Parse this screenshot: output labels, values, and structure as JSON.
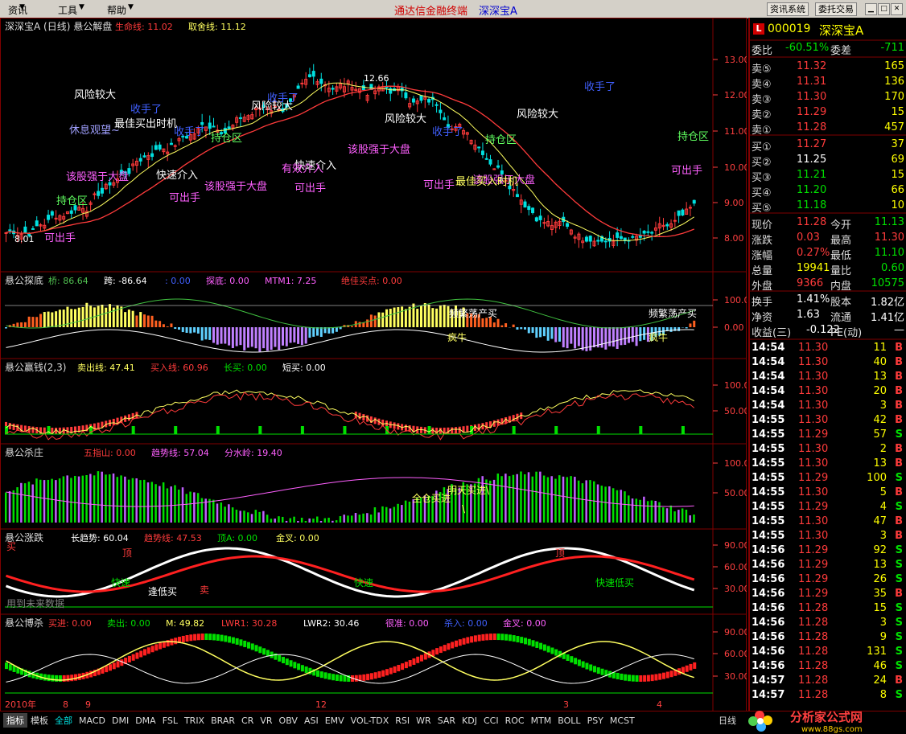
{
  "menubar": {
    "items": [
      "资讯",
      "工具",
      "帮助"
    ],
    "app_title": "通达信金融终端",
    "stock_title": "深深宝A",
    "buttons": [
      "资讯系统",
      "委托交易"
    ]
  },
  "main_chart": {
    "header": "深深宝A (日线) 悬公解盘",
    "lines": [
      {
        "label": "生命线:",
        "value": "11.02",
        "color": "#ff3b3b"
      },
      {
        "label": "取舍线:",
        "value": "11.12",
        "color": "#ffff60"
      }
    ],
    "y_ticks": [
      "13.00",
      "12.00",
      "11.00",
      "10.00",
      "9.00",
      "8.00"
    ],
    "high_label": "12.66",
    "low_label": "8.01",
    "annotations": [
      "风险较大",
      "风险较大",
      "风险较大",
      "风险较大",
      "收手了",
      "收手了",
      "收手了",
      "收手了",
      "收手了",
      "可出手",
      "可出手",
      "可出手",
      "可出手",
      "可出手",
      "持仓区",
      "持仓区",
      "持仓区",
      "持仓区",
      "该股强于大盘",
      "该股强于大盘",
      "该股强于大盘",
      "该股强于大盘",
      "快速介入",
      "快速介入",
      "有效介入",
      "休息观望~",
      "最佳买入时机",
      "最佳买出时机"
    ]
  },
  "panel2": {
    "header": "悬公探底",
    "fields": [
      {
        "label": "桥:",
        "value": "86.64",
        "color": "#50c050"
      },
      {
        "label": "跨:",
        "value": "-86.64",
        "color": "#ffffff"
      },
      {
        "label": ":",
        "value": "0.00",
        "color": "#4060ff"
      },
      {
        "label": "探底:",
        "value": "0.00",
        "color": "#ff60ff"
      },
      {
        "label": "MTM1:",
        "value": "7.25",
        "color": "#ff60ff"
      },
      {
        "label": "绝佳买点:",
        "value": "0.00",
        "color": "#ff3b3b"
      }
    ],
    "y_ticks": [
      "100.0",
      "0.00"
    ],
    "annotations": [
      "疯牛",
      "疯牛",
      "频繁荡产买",
      "频繁荡产买"
    ]
  },
  "panel3": {
    "header": "悬公赢钱(2,3)",
    "fields": [
      {
        "label": "卖出线:",
        "value": "47.41",
        "color": "#ffff60"
      },
      {
        "label": "买入线:",
        "value": "60.96",
        "color": "#ff3b3b"
      },
      {
        "label": "长买:",
        "value": "0.00",
        "color": "#00e000"
      },
      {
        "label": "短买:",
        "value": "0.00",
        "color": "#ffffff"
      }
    ],
    "y_ticks": [
      "100.0",
      "50.00"
    ]
  },
  "panel4": {
    "header": "悬公杀庄",
    "fields": [
      {
        "label": "五指山:",
        "value": "0.00",
        "color": "#ff3b3b"
      },
      {
        "label": "趋势线:",
        "value": "57.04",
        "color": "#ff60ff"
      },
      {
        "label": "分水岭:",
        "value": "19.40",
        "color": "#ff60ff"
      }
    ],
    "y_ticks": [
      "100.0",
      "50.00"
    ],
    "annotations": [
      "全仓买进",
      "明天买进\\",
      "\\"
    ]
  },
  "panel5": {
    "header": "悬公涨跌",
    "fields": [
      {
        "label": "长趋势:",
        "value": "60.04",
        "color": "#ffffff"
      },
      {
        "label": "趋势线:",
        "value": "47.53",
        "color": "#ff3b3b"
      },
      {
        "label": "顶A:",
        "value": "0.00",
        "color": "#00e000"
      },
      {
        "label": "金叉:",
        "value": "0.00",
        "color": "#ffff60"
      }
    ],
    "y_ticks": [
      "90.00",
      "60.00",
      "30.00"
    ],
    "annotations": [
      "快速",
      "快速",
      "快速低买",
      "逢低买",
      "买",
      "卖",
      "顶",
      "顶",
      "用到未来数据"
    ]
  },
  "panel6": {
    "header": "悬公博杀",
    "fields": [
      {
        "label": "买进:",
        "value": "0.00",
        "color": "#ff3b3b"
      },
      {
        "label": "卖出:",
        "value": "0.00",
        "color": "#00e000"
      },
      {
        "label": "M:",
        "value": "49.82",
        "color": "#ffff60"
      },
      {
        "label": "LWR1:",
        "value": "30.28",
        "color": "#ff3b3b"
      },
      {
        "label": "LWR2:",
        "value": "30.46",
        "color": "#ffffff"
      },
      {
        "label": "很准:",
        "value": "0.00",
        "color": "#ff60ff"
      },
      {
        "label": "杀入:",
        "value": "0.00",
        "color": "#4060ff"
      },
      {
        "label": "金叉:",
        "value": "0.00",
        "color": "#ff60ff"
      }
    ],
    "y_ticks": [
      "90.00",
      "60.00",
      "30.00"
    ]
  },
  "date_axis": [
    "2010年",
    "8",
    "9",
    "12",
    "3",
    "4"
  ],
  "bottom": {
    "tabs": [
      "指标",
      "模板",
      "全部",
      "MACD",
      "DMI",
      "DMA",
      "FSL",
      "TRIX",
      "BRAR",
      "CR",
      "VR",
      "OBV",
      "ASI",
      "EMV",
      "VOL-TDX",
      "RSI",
      "WR",
      "SAR",
      "KDJ",
      "CCI",
      "ROC",
      "MTM",
      "BOLL",
      "PSY",
      "MCST"
    ],
    "period": "日线",
    "logo_text": "分析家公式网",
    "logo_url": "www.88gs.com"
  },
  "quote": {
    "code": "000019",
    "name": "深深宝A",
    "wei_bi_label": "委比",
    "wei_bi": "-60.51%",
    "wei_cha_label": "委差",
    "wei_cha": "-711",
    "sells": [
      {
        "label": "卖⑤",
        "price": "11.32",
        "vol": "165"
      },
      {
        "label": "卖④",
        "price": "11.31",
        "vol": "136"
      },
      {
        "label": "卖③",
        "price": "11.30",
        "vol": "170"
      },
      {
        "label": "卖②",
        "price": "11.29",
        "vol": "15"
      },
      {
        "label": "卖①",
        "price": "11.28",
        "vol": "457"
      }
    ],
    "buys": [
      {
        "label": "买①",
        "price": "11.27",
        "vol": "37"
      },
      {
        "label": "买②",
        "price": "11.25",
        "vol": "69"
      },
      {
        "label": "买③",
        "price": "11.21",
        "vol": "15"
      },
      {
        "label": "买④",
        "price": "11.20",
        "vol": "66"
      },
      {
        "label": "买⑤",
        "price": "11.18",
        "vol": "10"
      }
    ],
    "stats": [
      {
        "l1": "现价",
        "v1": "11.28",
        "c1": "#ff3b3b",
        "l2": "今开",
        "v2": "11.13",
        "c2": "#00e000"
      },
      {
        "l1": "涨跌",
        "v1": "0.03",
        "c1": "#ff3b3b",
        "l2": "最高",
        "v2": "11.30",
        "c2": "#ff3b3b"
      },
      {
        "l1": "涨幅",
        "v1": "0.27%",
        "c1": "#ff3b3b",
        "l2": "最低",
        "v2": "11.10",
        "c2": "#00e000"
      },
      {
        "l1": "总量",
        "v1": "19941",
        "c1": "#ffff00",
        "l2": "量比",
        "v2": "0.60",
        "c2": "#00e000"
      },
      {
        "l1": "外盘",
        "v1": "9366",
        "c1": "#ff3b3b",
        "l2": "内盘",
        "v2": "10575",
        "c2": "#00e000"
      },
      {
        "l1": "换手",
        "v1": "1.41%",
        "c1": "#ffffff",
        "l2": "股本",
        "v2": "1.82亿",
        "c2": "#ffffff"
      },
      {
        "l1": "净资",
        "v1": "1.63",
        "c1": "#ffffff",
        "l2": "流通",
        "v2": "1.41亿",
        "c2": "#ffffff"
      },
      {
        "l1": "收益(三)",
        "v1": "-0.122",
        "c1": "#ffffff",
        "l2": "PE(动)",
        "v2": "—",
        "c2": "#ffffff"
      }
    ],
    "ticks": [
      {
        "time": "14:54",
        "price": "11.30",
        "vol": "11",
        "side": "B"
      },
      {
        "time": "14:54",
        "price": "11.30",
        "vol": "40",
        "side": "B"
      },
      {
        "time": "14:54",
        "price": "11.30",
        "vol": "13",
        "side": "B"
      },
      {
        "time": "14:54",
        "price": "11.30",
        "vol": "20",
        "side": "B"
      },
      {
        "time": "14:54",
        "price": "11.30",
        "vol": "3",
        "side": "B"
      },
      {
        "time": "14:55",
        "price": "11.30",
        "vol": "42",
        "side": "B"
      },
      {
        "time": "14:55",
        "price": "11.29",
        "vol": "57",
        "side": "S"
      },
      {
        "time": "14:55",
        "price": "11.30",
        "vol": "2",
        "side": "B"
      },
      {
        "time": "14:55",
        "price": "11.30",
        "vol": "13",
        "side": "B"
      },
      {
        "time": "14:55",
        "price": "11.29",
        "vol": "100",
        "side": "S"
      },
      {
        "time": "14:55",
        "price": "11.30",
        "vol": "5",
        "side": "B"
      },
      {
        "time": "14:55",
        "price": "11.29",
        "vol": "4",
        "side": "S"
      },
      {
        "time": "14:55",
        "price": "11.30",
        "vol": "47",
        "side": "B"
      },
      {
        "time": "14:55",
        "price": "11.30",
        "vol": "3",
        "side": "B"
      },
      {
        "time": "14:56",
        "price": "11.29",
        "vol": "92",
        "side": "S"
      },
      {
        "time": "14:56",
        "price": "11.29",
        "vol": "13",
        "side": "S"
      },
      {
        "time": "14:56",
        "price": "11.29",
        "vol": "26",
        "side": "S"
      },
      {
        "time": "14:56",
        "price": "11.29",
        "vol": "35",
        "side": "B"
      },
      {
        "time": "14:56",
        "price": "11.28",
        "vol": "15",
        "side": "S"
      },
      {
        "time": "14:56",
        "price": "11.28",
        "vol": "3",
        "side": "S"
      },
      {
        "time": "14:56",
        "price": "11.28",
        "vol": "9",
        "side": "S"
      },
      {
        "time": "14:56",
        "price": "11.28",
        "vol": "131",
        "side": "S"
      },
      {
        "time": "14:56",
        "price": "11.28",
        "vol": "46",
        "side": "S"
      },
      {
        "time": "14:57",
        "price": "11.28",
        "vol": "24",
        "side": "B"
      },
      {
        "time": "14:57",
        "price": "11.28",
        "vol": "8",
        "side": "S"
      }
    ]
  },
  "colors": {
    "up": "#ff3b3b",
    "down": "#00e0e0",
    "frame": "#800000",
    "bg": "#000000"
  }
}
